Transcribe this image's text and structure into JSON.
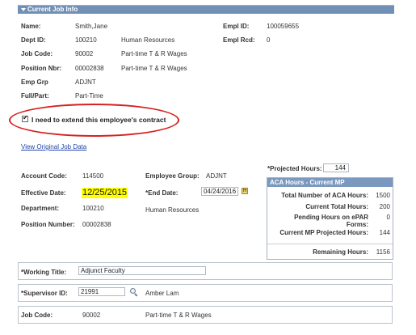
{
  "section": {
    "title": "Current Job Info"
  },
  "job_info": {
    "name_label": "Name:",
    "name_value": "Smith,Jane",
    "empl_id_label": "Empl ID:",
    "empl_id_value": "100059655",
    "dept_id_label": "Dept ID:",
    "dept_id_value": "100210",
    "dept_name": "Human Resources",
    "empl_rcd_label": "Empl Rcd:",
    "empl_rcd_value": "0",
    "job_code_label": "Job Code:",
    "job_code_value": "90002",
    "job_code_desc": "Part-time T & R Wages",
    "position_nbr_label": "Position Nbr:",
    "position_nbr_value": "00002838",
    "position_desc": "Part-time T & R Wages",
    "emp_grp_label": "Emp Grp",
    "emp_grp_value": "ADJNT",
    "full_part_label": "Full/Part:",
    "full_part_value": "Part-Time"
  },
  "extend": {
    "checked": true,
    "label": "I need to extend this employee's contract"
  },
  "view_link": "View Original Job Data",
  "contract": {
    "account_code_label": "Account Code:",
    "account_code_value": "114500",
    "employee_group_label": "Employee Group:",
    "employee_group_value": "ADJNT",
    "effective_date_label": "Effective Date:",
    "effective_date_value": "12/25/2015",
    "end_date_label": "*End Date:",
    "end_date_value": "04/24/2016",
    "department_label": "Department:",
    "department_value": "100210",
    "department_name": "Human Resources",
    "position_number_label": "Position Number:",
    "position_number_value": "00002838",
    "projected_hours_label": "*Projected Hours:",
    "projected_hours_value": "144"
  },
  "aca": {
    "title": "ACA Hours - Current MP",
    "rows": [
      {
        "label": "Total Number of ACA Hours:",
        "value": "1500"
      },
      {
        "label": "Current Total Hours:",
        "value": "200"
      },
      {
        "label": "Pending Hours on ePAR",
        "label2": "Forms:",
        "value": "0"
      },
      {
        "label": "Current MP Projected Hours:",
        "value": "144"
      }
    ],
    "remaining_label": "Remaining Hours:",
    "remaining_value": "1156"
  },
  "lower": {
    "working_title_label": "*Working Title:",
    "working_title_value": "Adjunct Faculty",
    "supervisor_label": "*Supervisor ID:",
    "supervisor_value": "21991",
    "supervisor_name": "Amber Lam",
    "job_code_label": "Job Code:",
    "job_code_value": "90002",
    "job_code_desc": "Part-time T & R Wages"
  },
  "colors": {
    "header_bar": "#7090b6",
    "annotation": "#d82020",
    "highlight": "#ffff00",
    "link": "#2244aa"
  },
  "icons": [
    "chevron-down-icon",
    "checkbox-checked-icon",
    "calendar-icon",
    "search-icon"
  ]
}
